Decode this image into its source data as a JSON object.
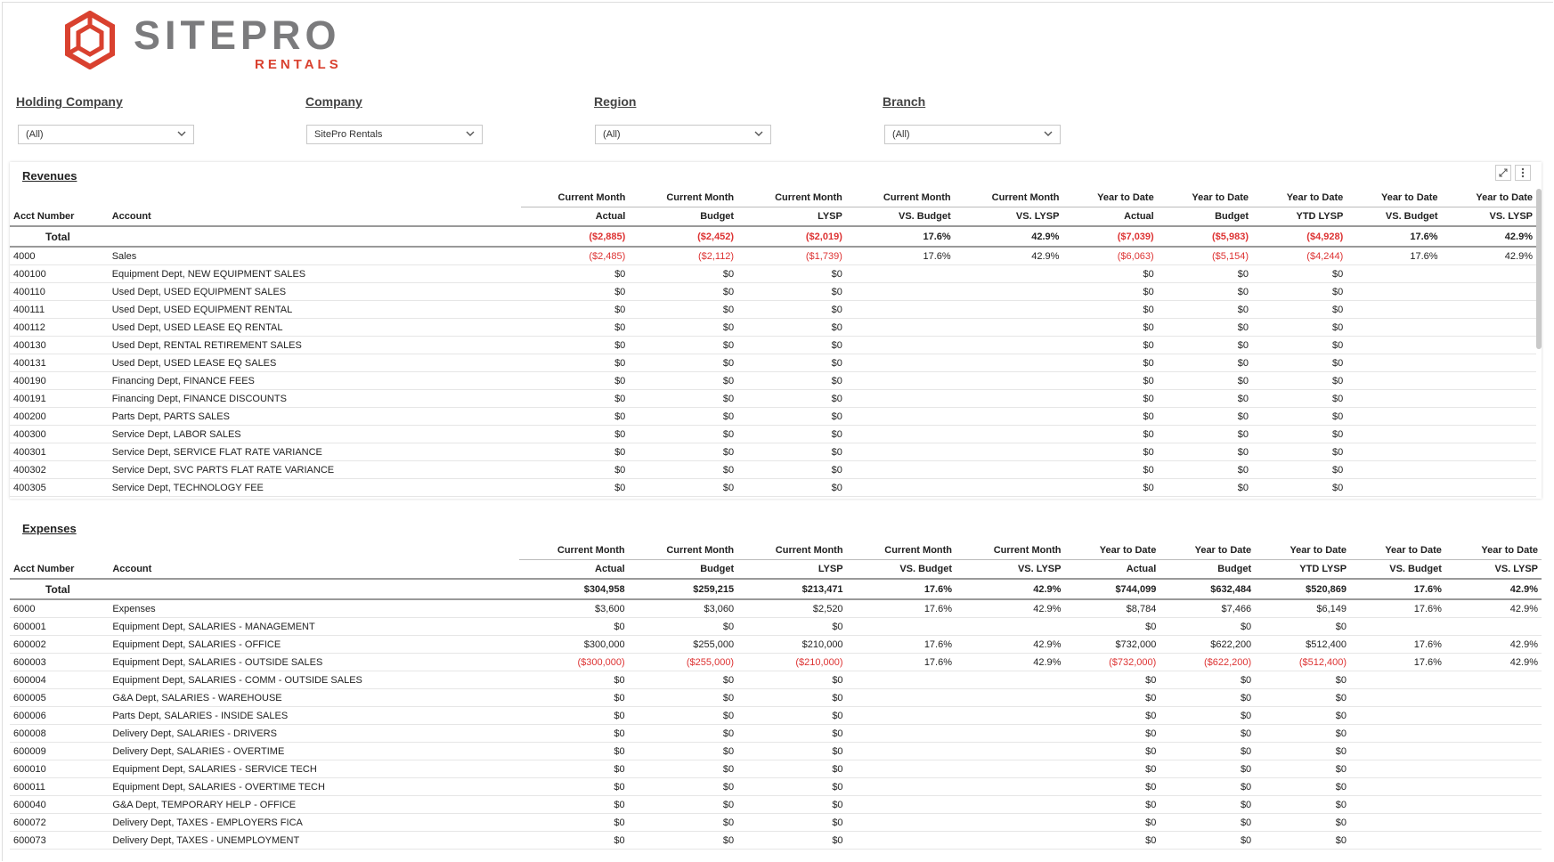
{
  "logo": {
    "word": "SITEPRO",
    "sub": "RENTALS"
  },
  "filters": [
    {
      "label": "Holding Company",
      "value": "(All)"
    },
    {
      "label": "Company",
      "value": "SitePro Rentals"
    },
    {
      "label": "Region",
      "value": "(All)"
    },
    {
      "label": "Branch",
      "value": "(All)"
    }
  ],
  "header_top": [
    "Current Month",
    "Current Month",
    "Current Month",
    "Current Month",
    "Current Month",
    "Year to Date",
    "Year to Date",
    "Year to Date",
    "Year to Date",
    "Year to Date"
  ],
  "header_bottom": [
    "Acct Number",
    "Account",
    "Actual",
    "Budget",
    "LYSP",
    "VS. Budget",
    "VS. LYSP",
    "Actual",
    "Budget",
    "YTD LYSP",
    "VS. Budget",
    "VS. LYSP"
  ],
  "revenues": {
    "title": "Revenues",
    "total_label": "Total",
    "total": [
      "($2,885)",
      "($2,452)",
      "($2,019)",
      "17.6%",
      "42.9%",
      "($7,039)",
      "($5,983)",
      "($4,928)",
      "17.6%",
      "42.9%"
    ],
    "rows": [
      [
        "4000",
        "Sales",
        "($2,485)",
        "($2,112)",
        "($1,739)",
        "17.6%",
        "42.9%",
        "($6,063)",
        "($5,154)",
        "($4,244)",
        "17.6%",
        "42.9%"
      ],
      [
        "400100",
        "Equipment Dept, NEW EQUIPMENT SALES",
        "$0",
        "$0",
        "$0",
        "",
        "",
        "$0",
        "$0",
        "$0",
        "",
        ""
      ],
      [
        "400110",
        "Used Dept, USED EQUIPMENT SALES",
        "$0",
        "$0",
        "$0",
        "",
        "",
        "$0",
        "$0",
        "$0",
        "",
        ""
      ],
      [
        "400111",
        "Used Dept, USED EQUIPMENT RENTAL",
        "$0",
        "$0",
        "$0",
        "",
        "",
        "$0",
        "$0",
        "$0",
        "",
        ""
      ],
      [
        "400112",
        "Used Dept, USED LEASE EQ RENTAL",
        "$0",
        "$0",
        "$0",
        "",
        "",
        "$0",
        "$0",
        "$0",
        "",
        ""
      ],
      [
        "400130",
        "Used Dept, RENTAL RETIREMENT SALES",
        "$0",
        "$0",
        "$0",
        "",
        "",
        "$0",
        "$0",
        "$0",
        "",
        ""
      ],
      [
        "400131",
        "Used Dept, USED LEASE EQ SALES",
        "$0",
        "$0",
        "$0",
        "",
        "",
        "$0",
        "$0",
        "$0",
        "",
        ""
      ],
      [
        "400190",
        "Financing Dept, FINANCE FEES",
        "$0",
        "$0",
        "$0",
        "",
        "",
        "$0",
        "$0",
        "$0",
        "",
        ""
      ],
      [
        "400191",
        "Financing Dept, FINANCE DISCOUNTS",
        "$0",
        "$0",
        "$0",
        "",
        "",
        "$0",
        "$0",
        "$0",
        "",
        ""
      ],
      [
        "400200",
        "Parts Dept, PARTS SALES",
        "$0",
        "$0",
        "$0",
        "",
        "",
        "$0",
        "$0",
        "$0",
        "",
        ""
      ],
      [
        "400300",
        "Service Dept, LABOR SALES",
        "$0",
        "$0",
        "$0",
        "",
        "",
        "$0",
        "$0",
        "$0",
        "",
        ""
      ],
      [
        "400301",
        "Service Dept, SERVICE FLAT RATE VARIANCE",
        "$0",
        "$0",
        "$0",
        "",
        "",
        "$0",
        "$0",
        "$0",
        "",
        ""
      ],
      [
        "400302",
        "Service Dept, SVC PARTS FLAT RATE VARIANCE",
        "$0",
        "$0",
        "$0",
        "",
        "",
        "$0",
        "$0",
        "$0",
        "",
        ""
      ],
      [
        "400305",
        "Service Dept, TECHNOLOGY FEE",
        "$0",
        "$0",
        "$0",
        "",
        "",
        "$0",
        "$0",
        "$0",
        "",
        ""
      ]
    ]
  },
  "expenses": {
    "title": "Expenses",
    "total_label": "Total",
    "total": [
      "$304,958",
      "$259,215",
      "$213,471",
      "17.6%",
      "42.9%",
      "$744,099",
      "$632,484",
      "$520,869",
      "17.6%",
      "42.9%"
    ],
    "rows": [
      [
        "6000",
        "Expenses",
        "$3,600",
        "$3,060",
        "$2,520",
        "17.6%",
        "42.9%",
        "$8,784",
        "$7,466",
        "$6,149",
        "17.6%",
        "42.9%"
      ],
      [
        "600001",
        "Equipment Dept, SALARIES - MANAGEMENT",
        "$0",
        "$0",
        "$0",
        "",
        "",
        "$0",
        "$0",
        "$0",
        "",
        ""
      ],
      [
        "600002",
        "Equipment Dept, SALARIES - OFFICE",
        "$300,000",
        "$255,000",
        "$210,000",
        "17.6%",
        "42.9%",
        "$732,000",
        "$622,200",
        "$512,400",
        "17.6%",
        "42.9%"
      ],
      [
        "600003",
        "Equipment Dept, SALARIES - OUTSIDE SALES",
        "($300,000)",
        "($255,000)",
        "($210,000)",
        "17.6%",
        "42.9%",
        "($732,000)",
        "($622,200)",
        "($512,400)",
        "17.6%",
        "42.9%"
      ],
      [
        "600004",
        "Equipment Dept, SALARIES - COMM - OUTSIDE SALES",
        "$0",
        "$0",
        "$0",
        "",
        "",
        "$0",
        "$0",
        "$0",
        "",
        ""
      ],
      [
        "600005",
        "G&A Dept, SALARIES - WAREHOUSE",
        "$0",
        "$0",
        "$0",
        "",
        "",
        "$0",
        "$0",
        "$0",
        "",
        ""
      ],
      [
        "600006",
        "Parts Dept, SALARIES - INSIDE SALES",
        "$0",
        "$0",
        "$0",
        "",
        "",
        "$0",
        "$0",
        "$0",
        "",
        ""
      ],
      [
        "600008",
        "Delivery Dept, SALARIES - DRIVERS",
        "$0",
        "$0",
        "$0",
        "",
        "",
        "$0",
        "$0",
        "$0",
        "",
        ""
      ],
      [
        "600009",
        "Delivery Dept, SALARIES - OVERTIME",
        "$0",
        "$0",
        "$0",
        "",
        "",
        "$0",
        "$0",
        "$0",
        "",
        ""
      ],
      [
        "600010",
        "Equipment Dept, SALARIES - SERVICE TECH",
        "$0",
        "$0",
        "$0",
        "",
        "",
        "$0",
        "$0",
        "$0",
        "",
        ""
      ],
      [
        "600011",
        "Equipment Dept, SALARIES - OVERTIME TECH",
        "$0",
        "$0",
        "$0",
        "",
        "",
        "$0",
        "$0",
        "$0",
        "",
        ""
      ],
      [
        "600040",
        "G&A Dept, TEMPORARY HELP - OFFICE",
        "$0",
        "$0",
        "$0",
        "",
        "",
        "$0",
        "$0",
        "$0",
        "",
        ""
      ],
      [
        "600072",
        "Delivery Dept, TAXES - EMPLOYERS FICA",
        "$0",
        "$0",
        "$0",
        "",
        "",
        "$0",
        "$0",
        "$0",
        "",
        ""
      ],
      [
        "600073",
        "Delivery Dept, TAXES - UNEMPLOYMENT",
        "$0",
        "$0",
        "$0",
        "",
        "",
        "$0",
        "$0",
        "$0",
        "",
        ""
      ]
    ]
  },
  "colors": {
    "negative": "#dd3333",
    "brand_red": "#d9412f",
    "brand_gray": "#7b7b7d"
  },
  "icons": {
    "expand": "expand-icon",
    "more": "more-vertical-icon",
    "dropdown": "chevron-down-icon"
  }
}
